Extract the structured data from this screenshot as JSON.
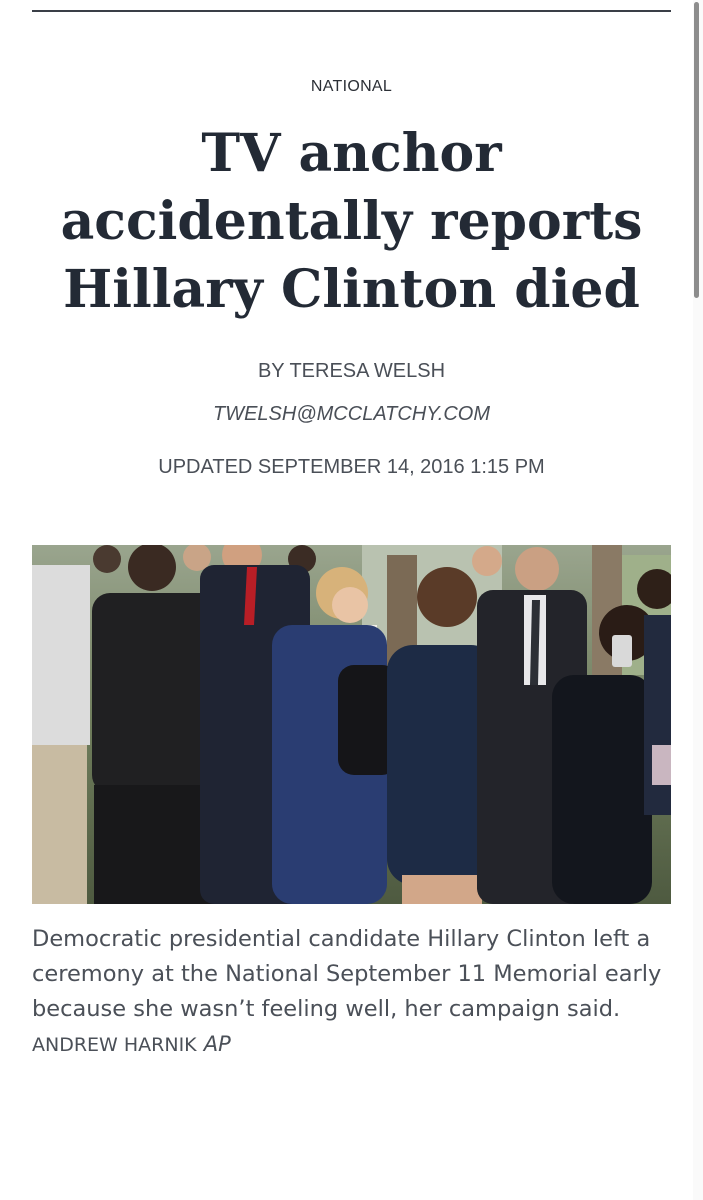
{
  "article": {
    "section": "NATIONAL",
    "headline": "TV anchor accidentally reports Hillary Clinton died",
    "byline": "BY TERESA WELSH",
    "email": "TWELSH@MCCLATCHY.COM",
    "updated": "UPDATED SEPTEMBER 14, 2016 1:15 PM"
  },
  "photo": {
    "caption": "Democratic presidential candidate Hillary Clinton left a ceremony at the National September 11 Memorial early because she wasn’t feeling well, her campaign said.",
    "credit_name": "ANDREW HARNIK",
    "credit_org": "AP"
  },
  "colors": {
    "headline": "#232a35",
    "meta_text": "#4a4f57",
    "rule": "#3a3f47"
  }
}
